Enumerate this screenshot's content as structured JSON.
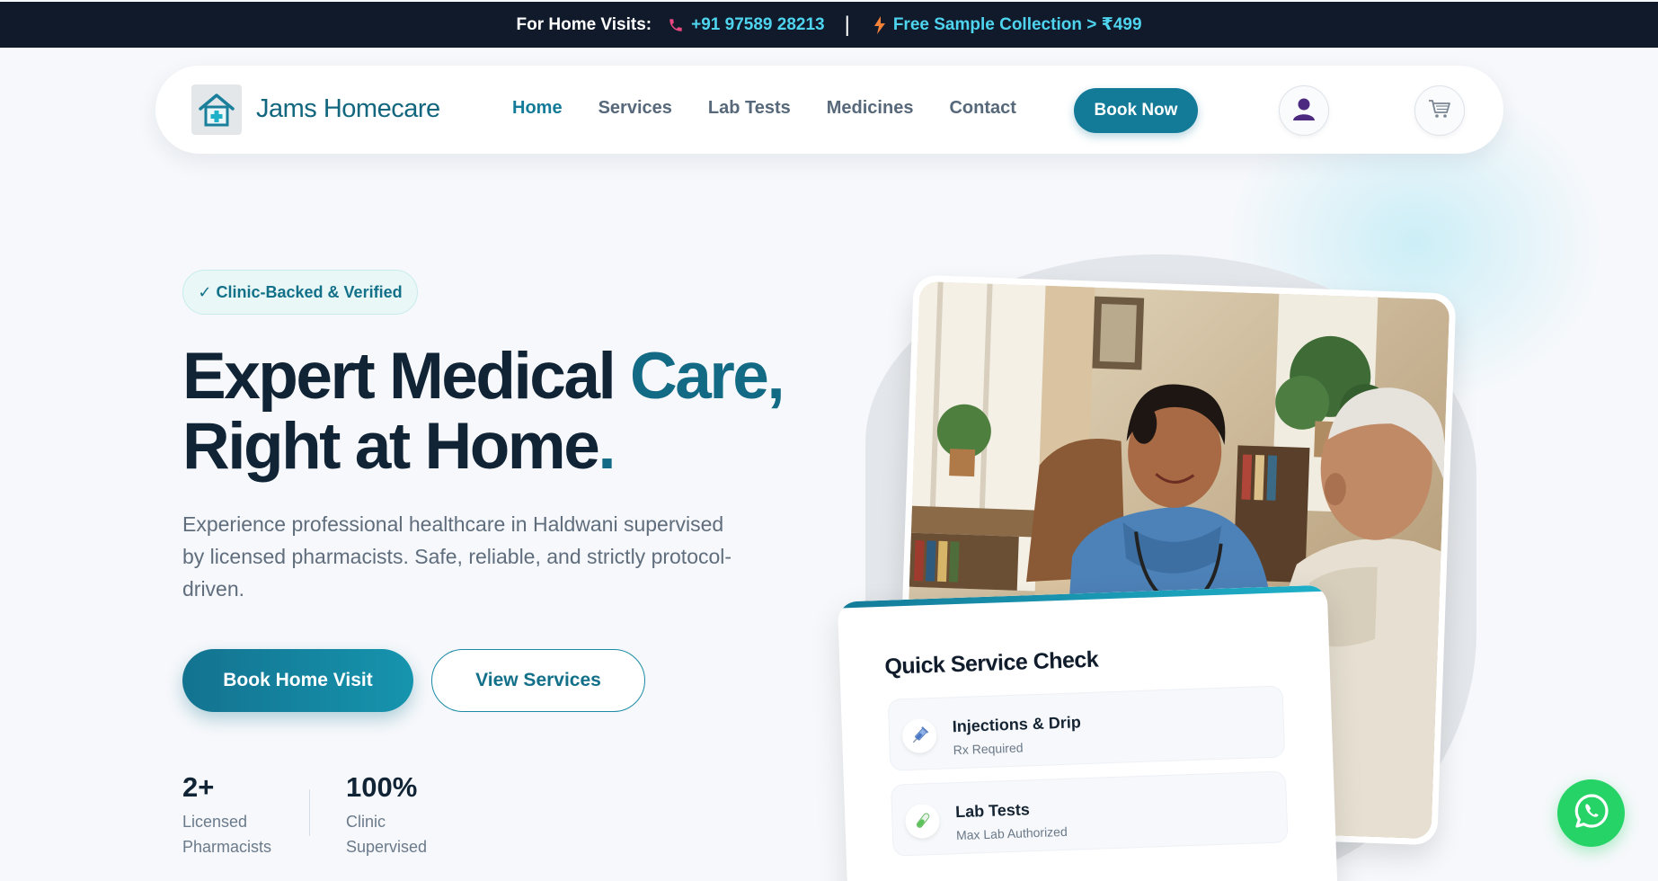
{
  "topbar": {
    "label": "For Home Visits:",
    "phone": "+91 97589 28213",
    "separator": "|",
    "promo": "Free Sample Collection > ₹499"
  },
  "nav": {
    "brand": "Jams Homecare",
    "links": [
      "Home",
      "Services",
      "Lab Tests",
      "Medicines",
      "Contact"
    ],
    "active": "Home",
    "cta": "Book Now"
  },
  "hero": {
    "badge": "✓ Clinic-Backed & Verified",
    "title_line1_a": "Expert ",
    "title_line1_b": "Medical ",
    "title_line1_c": "Care",
    "title_line1_d": ",",
    "title_line2_a": "Right ",
    "title_line2_b": "at ",
    "title_line2_c": "Home",
    "title_line2_d": ".",
    "description": "Experience professional healthcare in Haldwani supervised by licensed pharmacists. Safe, reliable, and strictly protocol-driven.",
    "primary_button": "Book Home Visit",
    "secondary_button": "View Services"
  },
  "stats": [
    {
      "value": "2+",
      "label_line1": "Licensed",
      "label_line2": "Pharmacists"
    },
    {
      "value": "100%",
      "label_line1": "Clinic",
      "label_line2": "Supervised"
    }
  ],
  "quick_service": {
    "title": "Quick Service Check",
    "items": [
      {
        "title": "Injections & Drip",
        "subtitle": "Rx Required",
        "icon": "syringe-icon"
      },
      {
        "title": "Lab Tests",
        "subtitle": "Max Lab Authorized",
        "icon": "test-tube-icon"
      }
    ]
  },
  "colors": {
    "primary": "#137b98",
    "topbar_bg": "#111a2b",
    "accent_cyan": "#4ed4ee",
    "whatsapp": "#25d366"
  },
  "icons": [
    "phone-icon",
    "bolt-icon",
    "home-plus-logo-icon",
    "user-icon",
    "cart-icon",
    "whatsapp-icon"
  ]
}
